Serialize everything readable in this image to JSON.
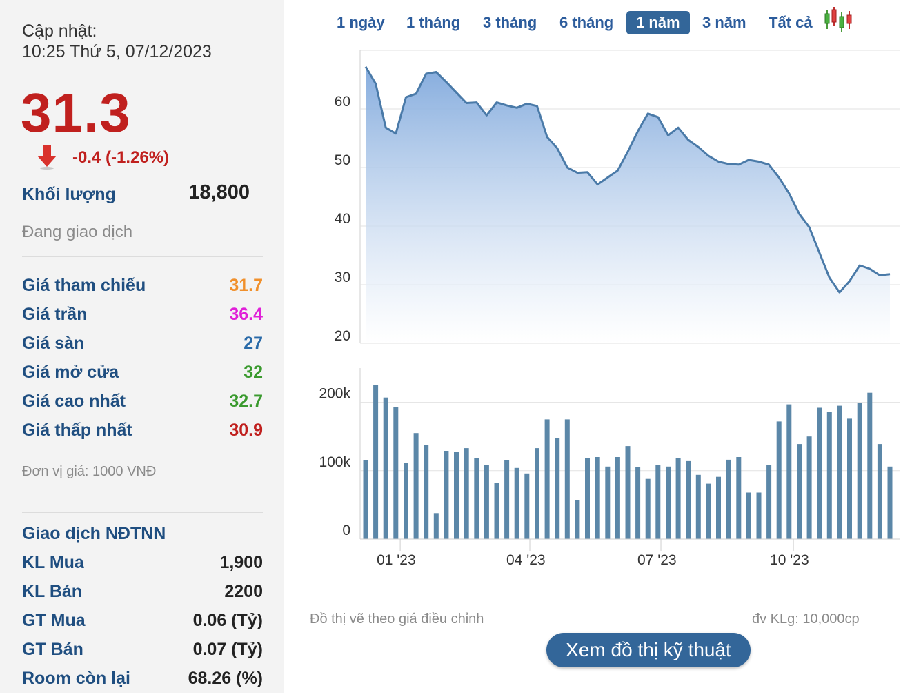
{
  "update": {
    "label": "Cập nhật:",
    "time": "10:25 Thứ 5, 07/12/2023"
  },
  "price": {
    "current": "31.3",
    "change": "-0.4 (-1.26%)"
  },
  "volume": {
    "label": "Khối lượng",
    "value": "18,800"
  },
  "status": "Đang giao dịch",
  "stats": [
    {
      "label": "Giá tham chiếu",
      "value": "31.7",
      "color": "#f0902c"
    },
    {
      "label": "Giá trần",
      "value": "36.4",
      "color": "#e020d8"
    },
    {
      "label": "Giá sàn",
      "value": "27",
      "color": "#2a6aa8"
    },
    {
      "label": "Giá mở cửa",
      "value": "32",
      "color": "#3a9a2e"
    },
    {
      "label": "Giá cao nhất",
      "value": "32.7",
      "color": "#3a9a2e"
    },
    {
      "label": "Giá thấp nhất",
      "value": "30.9",
      "color": "#c0201e"
    }
  ],
  "unit_note": "Đơn vị giá: 1000 VNĐ",
  "foreign": {
    "title": "Giao dịch NĐTNN",
    "rows": [
      {
        "label": "KL Mua",
        "value": "1,900"
      },
      {
        "label": "KL Bán",
        "value": "2200"
      },
      {
        "label": "GT Mua",
        "value": "0.06 (Tỷ)"
      },
      {
        "label": "GT Bán",
        "value": "0.07 (Tỷ)"
      },
      {
        "label": "Room còn lại",
        "value": "68.26 (%)"
      }
    ]
  },
  "tabs": [
    {
      "label": "1 ngày",
      "active": false
    },
    {
      "label": "1 tháng",
      "active": false
    },
    {
      "label": "3 tháng",
      "active": false
    },
    {
      "label": "6 tháng",
      "active": false
    },
    {
      "label": "1 năm",
      "active": true
    },
    {
      "label": "3 năm",
      "active": false
    },
    {
      "label": "Tất cả",
      "active": false
    }
  ],
  "chart_icon": "candlestick-icon",
  "footer": {
    "note": "Đồ thị vẽ theo giá điều chỉnh",
    "vol_unit": "đv KLg: 10,000cp",
    "button": "Xem đồ thị kỹ thuật"
  },
  "colors": {
    "line": "#4a7aa8",
    "bar": "#5b87a8",
    "accent": "#336699",
    "down": "#c0201e"
  },
  "chart_data": [
    {
      "type": "area",
      "title": "",
      "ylim": [
        20,
        70
      ],
      "yticks": [
        20,
        30,
        40,
        50,
        60
      ],
      "grid": true,
      "x": [
        "2022-12-08",
        "2022-12-15",
        "2022-12-22",
        "2022-12-29",
        "2023-01-05",
        "2023-01-12",
        "2023-01-19",
        "2023-01-26",
        "2023-02-02",
        "2023-02-09",
        "2023-02-16",
        "2023-02-23",
        "2023-03-02",
        "2023-03-09",
        "2023-03-16",
        "2023-03-23",
        "2023-03-30",
        "2023-04-06",
        "2023-04-13",
        "2023-04-20",
        "2023-04-27",
        "2023-05-04",
        "2023-05-11",
        "2023-05-18",
        "2023-05-25",
        "2023-06-01",
        "2023-06-08",
        "2023-06-15",
        "2023-06-22",
        "2023-06-29",
        "2023-07-06",
        "2023-07-13",
        "2023-07-20",
        "2023-07-27",
        "2023-08-03",
        "2023-08-10",
        "2023-08-17",
        "2023-08-24",
        "2023-08-31",
        "2023-09-07",
        "2023-09-14",
        "2023-09-21",
        "2023-09-28",
        "2023-10-05",
        "2023-10-12",
        "2023-10-19",
        "2023-10-26",
        "2023-11-02",
        "2023-11-09",
        "2023-11-16",
        "2023-11-23",
        "2023-11-30",
        "2023-12-07"
      ],
      "values": [
        67.2,
        64.3,
        56.8,
        55.8,
        62.0,
        62.6,
        66.0,
        66.3,
        64.6,
        62.8,
        61.0,
        61.1,
        58.9,
        61.1,
        60.6,
        60.2,
        60.9,
        60.5,
        55.2,
        53.3,
        50.0,
        49.1,
        49.2,
        47.1,
        48.3,
        49.5,
        52.7,
        56.2,
        59.2,
        58.6,
        55.5,
        56.8,
        54.7,
        53.5,
        52.0,
        51.0,
        50.6,
        50.5,
        51.3,
        51.0,
        50.5,
        48.3,
        45.6,
        42.1,
        39.8,
        35.5,
        31.2,
        28.7,
        30.6,
        33.3,
        32.7,
        31.6,
        31.8
      ]
    },
    {
      "type": "bar",
      "title": "",
      "ylim": [
        0,
        250000
      ],
      "yticks": [
        0,
        100000,
        200000
      ],
      "tick_labels": [
        "0",
        "100k",
        "200k"
      ],
      "x_tick_labels": [
        "01 '23",
        "04 '23",
        "07 '23",
        "10 '23"
      ],
      "x_tick_dates": [
        "2023-01-01",
        "2023-04-01",
        "2023-07-01",
        "2023-10-01"
      ],
      "x": [
        "2022-12-08",
        "2022-12-15",
        "2022-12-22",
        "2022-12-29",
        "2023-01-05",
        "2023-01-12",
        "2023-01-19",
        "2023-01-26",
        "2023-02-02",
        "2023-02-09",
        "2023-02-16",
        "2023-02-23",
        "2023-03-02",
        "2023-03-09",
        "2023-03-16",
        "2023-03-23",
        "2023-03-30",
        "2023-04-06",
        "2023-04-13",
        "2023-04-20",
        "2023-04-27",
        "2023-05-04",
        "2023-05-11",
        "2023-05-18",
        "2023-05-25",
        "2023-06-01",
        "2023-06-08",
        "2023-06-15",
        "2023-06-22",
        "2023-06-29",
        "2023-07-06",
        "2023-07-13",
        "2023-07-20",
        "2023-07-27",
        "2023-08-03",
        "2023-08-10",
        "2023-08-17",
        "2023-08-24",
        "2023-08-31",
        "2023-09-07",
        "2023-09-14",
        "2023-09-21",
        "2023-09-28",
        "2023-10-05",
        "2023-10-12",
        "2023-10-19",
        "2023-10-26",
        "2023-11-02",
        "2023-11-09",
        "2023-11-16",
        "2023-11-23",
        "2023-11-30",
        "2023-12-07"
      ],
      "values": [
        115000,
        225000,
        207000,
        193000,
        111000,
        155000,
        138000,
        38000,
        129000,
        128000,
        133000,
        118000,
        108000,
        82000,
        115000,
        104000,
        96000,
        133000,
        175000,
        148000,
        175000,
        57000,
        118000,
        120000,
        106000,
        120000,
        136000,
        105000,
        88000,
        108000,
        106000,
        118000,
        114000,
        94000,
        81000,
        91000,
        116000,
        120000,
        68000,
        68000,
        108000,
        172000,
        197000,
        139000,
        150000,
        192000,
        186000,
        195000,
        176000,
        199000,
        214000,
        139000,
        106000
      ]
    }
  ]
}
